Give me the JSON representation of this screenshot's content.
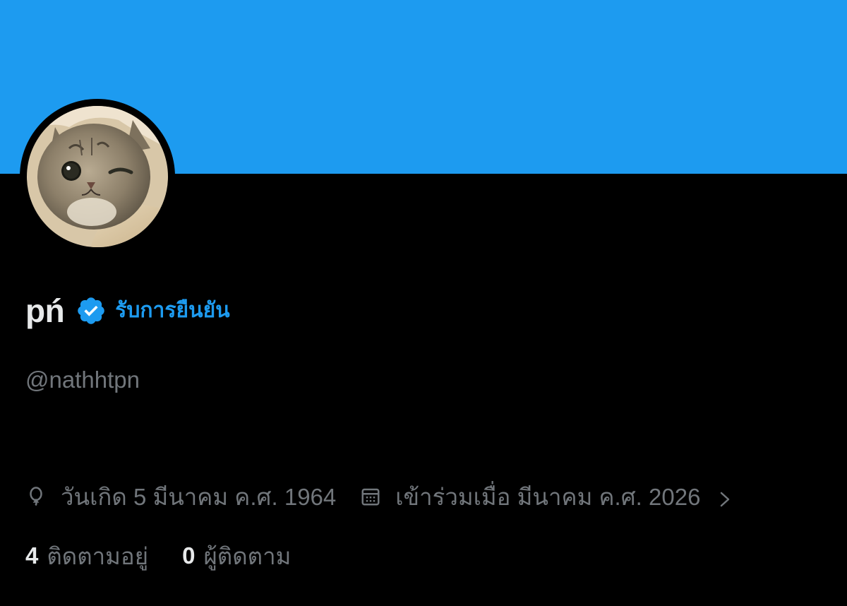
{
  "profile": {
    "display_name": "pń",
    "verified_icon": "verified-badge-icon",
    "verify_link": "รับการยืนยัน",
    "handle": "@nathhtpn",
    "banner_color": "#1d9bf0",
    "avatar_description": "cat-avatar"
  },
  "meta": {
    "birthday_icon": "balloon-icon",
    "birthday": "วันเกิด 5 มีนาคม ค.ศ. 1964",
    "joined_icon": "calendar-icon",
    "joined": "เข้าร่วมเมื่อ มีนาคม ค.ศ. 2026",
    "more_icon": "chevron-right-icon"
  },
  "stats": {
    "following_count": "4",
    "following_label": "ติดตามอยู่",
    "followers_count": "0",
    "followers_label": "ผู้ติดตาม"
  },
  "colors": {
    "background": "#000000",
    "accent": "#1d9bf0",
    "primary_text": "#e7e9ea",
    "secondary_text": "#71767b"
  }
}
